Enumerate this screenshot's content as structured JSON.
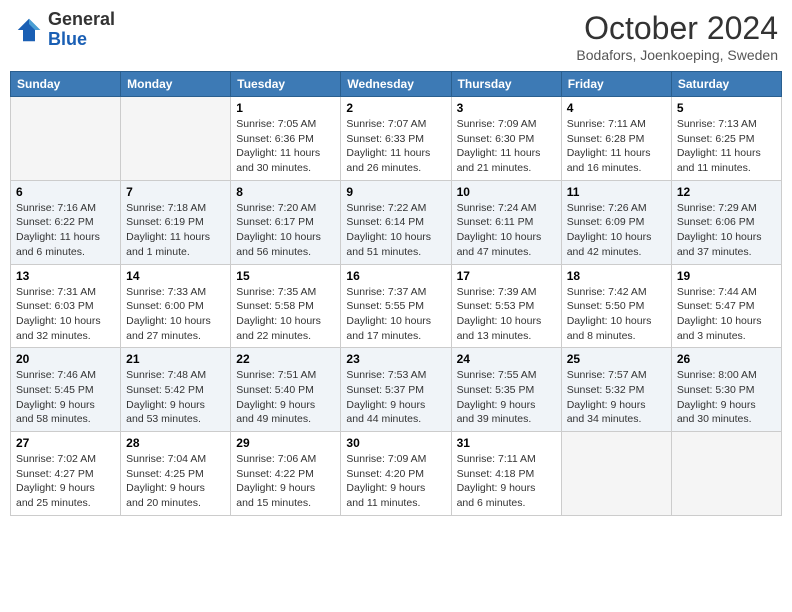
{
  "header": {
    "logo_line1": "General",
    "logo_line2": "Blue",
    "month": "October 2024",
    "location": "Bodafors, Joenkoeping, Sweden"
  },
  "days_of_week": [
    "Sunday",
    "Monday",
    "Tuesday",
    "Wednesday",
    "Thursday",
    "Friday",
    "Saturday"
  ],
  "weeks": [
    [
      {
        "day": "",
        "info": ""
      },
      {
        "day": "",
        "info": ""
      },
      {
        "day": "1",
        "info": "Sunrise: 7:05 AM\nSunset: 6:36 PM\nDaylight: 11 hours and 30 minutes."
      },
      {
        "day": "2",
        "info": "Sunrise: 7:07 AM\nSunset: 6:33 PM\nDaylight: 11 hours and 26 minutes."
      },
      {
        "day": "3",
        "info": "Sunrise: 7:09 AM\nSunset: 6:30 PM\nDaylight: 11 hours and 21 minutes."
      },
      {
        "day": "4",
        "info": "Sunrise: 7:11 AM\nSunset: 6:28 PM\nDaylight: 11 hours and 16 minutes."
      },
      {
        "day": "5",
        "info": "Sunrise: 7:13 AM\nSunset: 6:25 PM\nDaylight: 11 hours and 11 minutes."
      }
    ],
    [
      {
        "day": "6",
        "info": "Sunrise: 7:16 AM\nSunset: 6:22 PM\nDaylight: 11 hours and 6 minutes."
      },
      {
        "day": "7",
        "info": "Sunrise: 7:18 AM\nSunset: 6:19 PM\nDaylight: 11 hours and 1 minute."
      },
      {
        "day": "8",
        "info": "Sunrise: 7:20 AM\nSunset: 6:17 PM\nDaylight: 10 hours and 56 minutes."
      },
      {
        "day": "9",
        "info": "Sunrise: 7:22 AM\nSunset: 6:14 PM\nDaylight: 10 hours and 51 minutes."
      },
      {
        "day": "10",
        "info": "Sunrise: 7:24 AM\nSunset: 6:11 PM\nDaylight: 10 hours and 47 minutes."
      },
      {
        "day": "11",
        "info": "Sunrise: 7:26 AM\nSunset: 6:09 PM\nDaylight: 10 hours and 42 minutes."
      },
      {
        "day": "12",
        "info": "Sunrise: 7:29 AM\nSunset: 6:06 PM\nDaylight: 10 hours and 37 minutes."
      }
    ],
    [
      {
        "day": "13",
        "info": "Sunrise: 7:31 AM\nSunset: 6:03 PM\nDaylight: 10 hours and 32 minutes."
      },
      {
        "day": "14",
        "info": "Sunrise: 7:33 AM\nSunset: 6:00 PM\nDaylight: 10 hours and 27 minutes."
      },
      {
        "day": "15",
        "info": "Sunrise: 7:35 AM\nSunset: 5:58 PM\nDaylight: 10 hours and 22 minutes."
      },
      {
        "day": "16",
        "info": "Sunrise: 7:37 AM\nSunset: 5:55 PM\nDaylight: 10 hours and 17 minutes."
      },
      {
        "day": "17",
        "info": "Sunrise: 7:39 AM\nSunset: 5:53 PM\nDaylight: 10 hours and 13 minutes."
      },
      {
        "day": "18",
        "info": "Sunrise: 7:42 AM\nSunset: 5:50 PM\nDaylight: 10 hours and 8 minutes."
      },
      {
        "day": "19",
        "info": "Sunrise: 7:44 AM\nSunset: 5:47 PM\nDaylight: 10 hours and 3 minutes."
      }
    ],
    [
      {
        "day": "20",
        "info": "Sunrise: 7:46 AM\nSunset: 5:45 PM\nDaylight: 9 hours and 58 minutes."
      },
      {
        "day": "21",
        "info": "Sunrise: 7:48 AM\nSunset: 5:42 PM\nDaylight: 9 hours and 53 minutes."
      },
      {
        "day": "22",
        "info": "Sunrise: 7:51 AM\nSunset: 5:40 PM\nDaylight: 9 hours and 49 minutes."
      },
      {
        "day": "23",
        "info": "Sunrise: 7:53 AM\nSunset: 5:37 PM\nDaylight: 9 hours and 44 minutes."
      },
      {
        "day": "24",
        "info": "Sunrise: 7:55 AM\nSunset: 5:35 PM\nDaylight: 9 hours and 39 minutes."
      },
      {
        "day": "25",
        "info": "Sunrise: 7:57 AM\nSunset: 5:32 PM\nDaylight: 9 hours and 34 minutes."
      },
      {
        "day": "26",
        "info": "Sunrise: 8:00 AM\nSunset: 5:30 PM\nDaylight: 9 hours and 30 minutes."
      }
    ],
    [
      {
        "day": "27",
        "info": "Sunrise: 7:02 AM\nSunset: 4:27 PM\nDaylight: 9 hours and 25 minutes."
      },
      {
        "day": "28",
        "info": "Sunrise: 7:04 AM\nSunset: 4:25 PM\nDaylight: 9 hours and 20 minutes."
      },
      {
        "day": "29",
        "info": "Sunrise: 7:06 AM\nSunset: 4:22 PM\nDaylight: 9 hours and 15 minutes."
      },
      {
        "day": "30",
        "info": "Sunrise: 7:09 AM\nSunset: 4:20 PM\nDaylight: 9 hours and 11 minutes."
      },
      {
        "day": "31",
        "info": "Sunrise: 7:11 AM\nSunset: 4:18 PM\nDaylight: 9 hours and 6 minutes."
      },
      {
        "day": "",
        "info": ""
      },
      {
        "day": "",
        "info": ""
      }
    ]
  ]
}
